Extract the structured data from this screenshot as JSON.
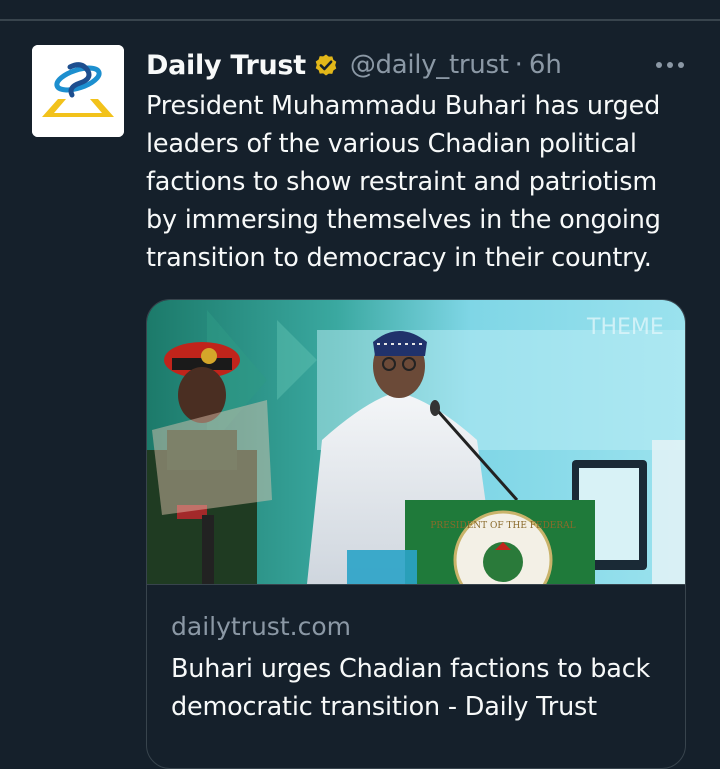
{
  "tweet": {
    "author": {
      "display_name": "Daily Trust",
      "handle": "@daily_trust",
      "verified_badge_color": "#e2b719",
      "avatar_icon": "daily-trust-logo"
    },
    "separator": "·",
    "timestamp": "6h",
    "more_icon": "more-horizontal-icon",
    "text": "President Muhammadu Buhari has urged leaders of the various Chadian political factions to show restraint and patriotism by immersing themselves in the ongoing transition to democracy in their country.",
    "card": {
      "domain": "dailytrust.com",
      "title": "Buhari urges Chadian factions to back democratic transition - Daily Trust",
      "image_backdrop_text": "THEME",
      "podium_seal_text": "PRESIDENT OF THE FEDERAL"
    }
  },
  "colors": {
    "background": "#15202b",
    "text_primary": "#f7f9f9",
    "text_secondary": "#8b98a5",
    "border": "#38444d"
  }
}
